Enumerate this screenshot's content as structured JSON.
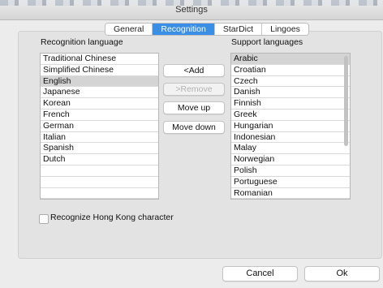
{
  "window": {
    "title": "Settings"
  },
  "tabs": [
    {
      "label": "General",
      "active": false
    },
    {
      "label": "Recognition",
      "active": true
    },
    {
      "label": "StarDict",
      "active": false
    },
    {
      "label": "Lingoes",
      "active": false
    }
  ],
  "recognition": {
    "heading": "Recognition language",
    "items": [
      "Traditional Chinese",
      "Simplified Chinese",
      "English",
      "Japanese",
      "Korean",
      "French",
      "German",
      "Italian",
      "Spanish",
      "Dutch",
      "",
      "",
      ""
    ],
    "selected_index": 2
  },
  "support": {
    "heading": "Support languages",
    "items": [
      "Arabic",
      "Croatian",
      "Czech",
      "Danish",
      "Finnish",
      "Greek",
      "Hungarian",
      "Indonesian",
      "Malay",
      "Norwegian",
      "Polish",
      "Portuguese",
      "Romanian"
    ],
    "selected_index": 0
  },
  "buttons": {
    "add": "<Add",
    "remove": ">Remove",
    "move_up": "Move up",
    "move_down": "Move down",
    "cancel": "Cancel",
    "ok": "Ok"
  },
  "options": {
    "hong_kong_label": "Recognize Hong Kong character",
    "hong_kong_checked": false
  },
  "colors": {
    "accent": "#3a8ee6",
    "selection": "#d4d4d4"
  }
}
